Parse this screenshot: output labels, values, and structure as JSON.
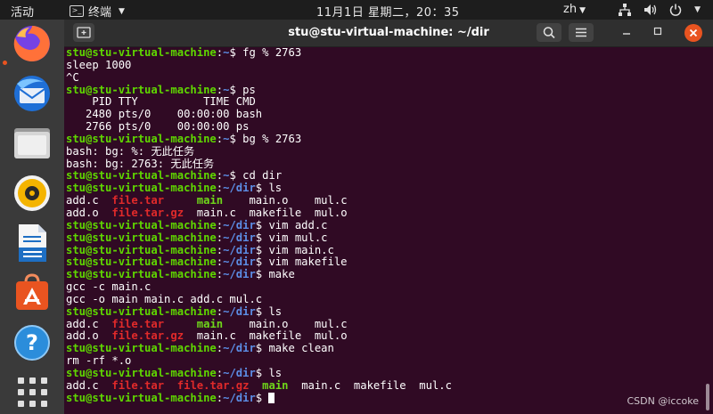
{
  "topbar": {
    "activities": "活动",
    "app_name": "终端",
    "clock": "11月1日 星期二，20：35",
    "input_method": "zh"
  },
  "window": {
    "title": "stu@stu-virtual-machine: ~/dir"
  },
  "terminal": {
    "lines": [
      [
        {
          "t": "stu@stu-virtual-machine",
          "c": "u"
        },
        {
          "t": ":",
          "c": "t"
        },
        {
          "t": "~",
          "c": "p"
        },
        {
          "t": "$ fg % 2763",
          "c": "t"
        }
      ],
      [
        {
          "t": "sleep 1000",
          "c": "t"
        }
      ],
      [
        {
          "t": "^C",
          "c": "t"
        }
      ],
      [
        {
          "t": "stu@stu-virtual-machine",
          "c": "u"
        },
        {
          "t": ":",
          "c": "t"
        },
        {
          "t": "~",
          "c": "p"
        },
        {
          "t": "$ ps",
          "c": "t"
        }
      ],
      [
        {
          "t": "    PID TTY          TIME CMD",
          "c": "t"
        }
      ],
      [
        {
          "t": "   2480 pts/0    00:00:00 bash",
          "c": "t"
        }
      ],
      [
        {
          "t": "   2766 pts/0    00:00:00 ps",
          "c": "t"
        }
      ],
      [
        {
          "t": "stu@stu-virtual-machine",
          "c": "u"
        },
        {
          "t": ":",
          "c": "t"
        },
        {
          "t": "~",
          "c": "p"
        },
        {
          "t": "$ bg % 2763",
          "c": "t"
        }
      ],
      [
        {
          "t": "bash: bg: %: 无此任务",
          "c": "t"
        }
      ],
      [
        {
          "t": "bash: bg: 2763: 无此任务",
          "c": "t"
        }
      ],
      [
        {
          "t": "stu@stu-virtual-machine",
          "c": "u"
        },
        {
          "t": ":",
          "c": "t"
        },
        {
          "t": "~",
          "c": "p"
        },
        {
          "t": "$ cd dir",
          "c": "t"
        }
      ],
      [
        {
          "t": "stu@stu-virtual-machine",
          "c": "u"
        },
        {
          "t": ":",
          "c": "t"
        },
        {
          "t": "~/dir",
          "c": "p"
        },
        {
          "t": "$ ls",
          "c": "t"
        }
      ],
      [
        {
          "t": "add.c  ",
          "c": "t"
        },
        {
          "t": "file.tar",
          "c": "red"
        },
        {
          "t": "     ",
          "c": "t"
        },
        {
          "t": "main",
          "c": "grn"
        },
        {
          "t": "    main.o    mul.c",
          "c": "t"
        }
      ],
      [
        {
          "t": "add.o  ",
          "c": "t"
        },
        {
          "t": "file.tar.gz",
          "c": "red"
        },
        {
          "t": "  main.c  makefile  mul.o",
          "c": "t"
        }
      ],
      [
        {
          "t": "stu@stu-virtual-machine",
          "c": "u"
        },
        {
          "t": ":",
          "c": "t"
        },
        {
          "t": "~/dir",
          "c": "p"
        },
        {
          "t": "$ vim add.c",
          "c": "t"
        }
      ],
      [
        {
          "t": "stu@stu-virtual-machine",
          "c": "u"
        },
        {
          "t": ":",
          "c": "t"
        },
        {
          "t": "~/dir",
          "c": "p"
        },
        {
          "t": "$ vim mul.c",
          "c": "t"
        }
      ],
      [
        {
          "t": "stu@stu-virtual-machine",
          "c": "u"
        },
        {
          "t": ":",
          "c": "t"
        },
        {
          "t": "~/dir",
          "c": "p"
        },
        {
          "t": "$ vim main.c",
          "c": "t"
        }
      ],
      [
        {
          "t": "stu@stu-virtual-machine",
          "c": "u"
        },
        {
          "t": ":",
          "c": "t"
        },
        {
          "t": "~/dir",
          "c": "p"
        },
        {
          "t": "$ vim makefile",
          "c": "t"
        }
      ],
      [
        {
          "t": "stu@stu-virtual-machine",
          "c": "u"
        },
        {
          "t": ":",
          "c": "t"
        },
        {
          "t": "~/dir",
          "c": "p"
        },
        {
          "t": "$ make",
          "c": "t"
        }
      ],
      [
        {
          "t": "gcc -c main.c",
          "c": "t"
        }
      ],
      [
        {
          "t": "gcc -o main main.c add.c mul.c",
          "c": "t"
        }
      ],
      [
        {
          "t": "stu@stu-virtual-machine",
          "c": "u"
        },
        {
          "t": ":",
          "c": "t"
        },
        {
          "t": "~/dir",
          "c": "p"
        },
        {
          "t": "$ ls",
          "c": "t"
        }
      ],
      [
        {
          "t": "add.c  ",
          "c": "t"
        },
        {
          "t": "file.tar",
          "c": "red"
        },
        {
          "t": "     ",
          "c": "t"
        },
        {
          "t": "main",
          "c": "grn"
        },
        {
          "t": "    main.o    mul.c",
          "c": "t"
        }
      ],
      [
        {
          "t": "add.o  ",
          "c": "t"
        },
        {
          "t": "file.tar.gz",
          "c": "red"
        },
        {
          "t": "  main.c  makefile  mul.o",
          "c": "t"
        }
      ],
      [
        {
          "t": "stu@stu-virtual-machine",
          "c": "u"
        },
        {
          "t": ":",
          "c": "t"
        },
        {
          "t": "~/dir",
          "c": "p"
        },
        {
          "t": "$ make clean",
          "c": "t"
        }
      ],
      [
        {
          "t": "rm -rf *.o",
          "c": "t"
        }
      ],
      [
        {
          "t": "stu@stu-virtual-machine",
          "c": "u"
        },
        {
          "t": ":",
          "c": "t"
        },
        {
          "t": "~/dir",
          "c": "p"
        },
        {
          "t": "$ ls",
          "c": "t"
        }
      ],
      [
        {
          "t": "add.c  ",
          "c": "t"
        },
        {
          "t": "file.tar",
          "c": "red"
        },
        {
          "t": "  ",
          "c": "t"
        },
        {
          "t": "file.tar.gz",
          "c": "red"
        },
        {
          "t": "  ",
          "c": "t"
        },
        {
          "t": "main",
          "c": "grn"
        },
        {
          "t": "  main.c  makefile  mul.c",
          "c": "t"
        }
      ],
      [
        {
          "t": "stu@stu-virtual-machine",
          "c": "u"
        },
        {
          "t": ":",
          "c": "t"
        },
        {
          "t": "~/dir",
          "c": "p"
        },
        {
          "t": "$ ",
          "c": "t"
        }
      ]
    ]
  },
  "watermark": "CSDN @iccoke",
  "colors": {
    "prompt_user": "#5fd700",
    "prompt_path": "#5c8ee6",
    "archive_file": "#e02a2a",
    "executable_file": "#6fd71a",
    "terminal_bg": "#300a24",
    "accent": "#e95420"
  },
  "icons": {
    "dock": [
      "firefox-icon",
      "thunderbird-icon",
      "files-icon",
      "rhythmbox-icon",
      "libreoffice-writer-icon",
      "ubuntu-software-icon",
      "help-icon",
      "show-apps-icon"
    ],
    "tray": [
      "network-icon",
      "volume-icon",
      "power-icon"
    ]
  }
}
